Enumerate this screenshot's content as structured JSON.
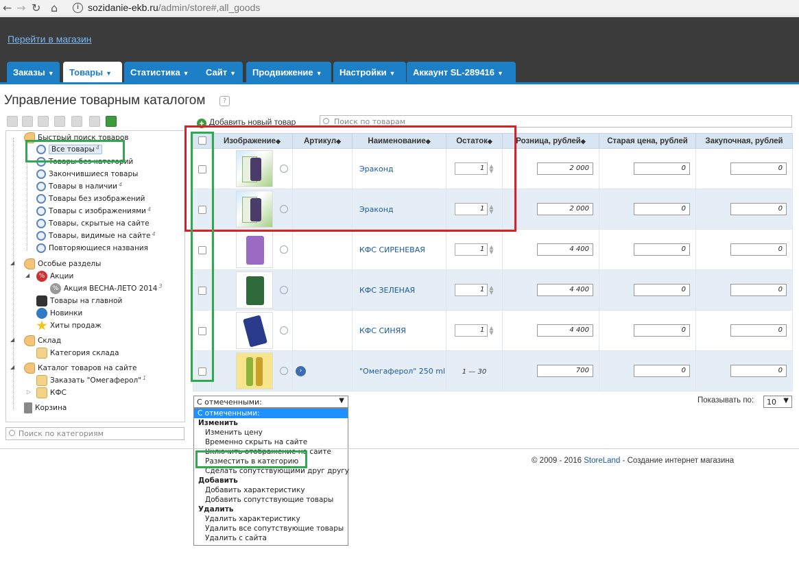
{
  "browser": {
    "url_domain": "sozidanie-ekb.ru",
    "url_path": "/admin/store#,all_goods"
  },
  "header": {
    "shop_link": "Перейти в магазин",
    "tabs": [
      {
        "label": "Заказы"
      },
      {
        "label": "Товары"
      },
      {
        "label": "Статистика"
      },
      {
        "label": "Сайт"
      },
      {
        "label": "Продвижение"
      },
      {
        "label": "Настройки"
      },
      {
        "label": "Аккаунт SL-289416"
      }
    ]
  },
  "page": {
    "title": "Управление товарным каталогом",
    "help": "?"
  },
  "tree": {
    "quick_search": "Быстрый поиск товаров",
    "quick_items": [
      {
        "label": "Все товары",
        "count": "4"
      },
      {
        "label": "Товары без категорий",
        "count": ""
      },
      {
        "label": "Закончившиеся товары",
        "count": ""
      },
      {
        "label": "Товары в наличии",
        "count": "4"
      },
      {
        "label": "Товары без изображений",
        "count": ""
      },
      {
        "label": "Товары с изображениями",
        "count": "4"
      },
      {
        "label": "Товары, скрытые на сайте",
        "count": ""
      },
      {
        "label": "Товары, видимые на сайте",
        "count": "4"
      },
      {
        "label": "Повторяющиеся названия",
        "count": ""
      }
    ],
    "special": "Особые разделы",
    "promos": "Акции",
    "promo_item": "Акция ВЕСНА-ЛЕТО 2014",
    "promo_item_count": "3",
    "on_main": "Товары на главной",
    "news": "Новинки",
    "hits": "Хиты продаж",
    "warehouse": "Склад",
    "warehouse_cat": "Категория склада",
    "catalog": "Каталог товаров на сайте",
    "cat_order": "Заказать \"Омегаферол\"",
    "cat_order_count": "1",
    "cat_kfs": "КФС",
    "trash": "Корзина",
    "search_placeholder": "Поиск по категориям"
  },
  "toolbar": {
    "add_product": "Добавить новый товар",
    "search_placeholder": "Поиск по товарам"
  },
  "table": {
    "headers": {
      "image": "Изображение",
      "sku": "Артикул",
      "name": "Наименование",
      "stock": "Остаток",
      "retail": "Розница, рублей",
      "old_price": "Старая цена, рублей",
      "purchase": "Закупочная, рублей"
    },
    "rows": [
      {
        "name": "Эраконд",
        "stock": "1",
        "retail": "2 000",
        "old": "0",
        "purchase": "0"
      },
      {
        "name": "Эраконд",
        "stock": "1",
        "retail": "2 000",
        "old": "0",
        "purchase": "0"
      },
      {
        "name": "КФС СИРЕНЕВАЯ",
        "stock": "1",
        "retail": "4 400",
        "old": "0",
        "purchase": "0"
      },
      {
        "name": "КФС ЗЕЛЕНАЯ",
        "stock": "1",
        "retail": "4 400",
        "old": "0",
        "purchase": "0"
      },
      {
        "name": "КФС СИНЯЯ",
        "stock": "1",
        "retail": "4 400",
        "old": "0",
        "purchase": "0"
      },
      {
        "name": "\"Омегаферол\" 250 ml",
        "stock_range": "1 — 30",
        "retail": "700",
        "old": "0",
        "purchase": "0"
      }
    ]
  },
  "bulk": {
    "select_value": "С отмеченными:",
    "options": [
      {
        "label": "С отмеченными:",
        "kind": "selected"
      },
      {
        "label": "Изменить",
        "kind": "group"
      },
      {
        "label": "Изменить цену",
        "kind": "opt"
      },
      {
        "label": "Временно скрыть на сайте",
        "kind": "opt"
      },
      {
        "label": "Включить отображение на сайте",
        "kind": "opt"
      },
      {
        "label": "Разместить в категорию",
        "kind": "opt"
      },
      {
        "label": "Сделать сопутствующими друг другу",
        "kind": "opt"
      },
      {
        "label": "Добавить",
        "kind": "group"
      },
      {
        "label": "Добавить характеристику",
        "kind": "opt"
      },
      {
        "label": "Добавить сопутствующие товары",
        "kind": "opt"
      },
      {
        "label": "Удалить",
        "kind": "group"
      },
      {
        "label": "Удалить характеристику",
        "kind": "opt"
      },
      {
        "label": "Удалить все сопутствующие товары",
        "kind": "opt"
      },
      {
        "label": "Удалить с сайта",
        "kind": "opt"
      }
    ]
  },
  "pagination": {
    "per_page_label": "Показывать по:",
    "per_page_value": "10"
  },
  "footer": {
    "copyright_prefix": "© 2009 - 2016",
    "brand": "StoreLand",
    "suffix": "- Создание интернет магазина"
  },
  "colors": {
    "accent": "#1d7fc6",
    "highlight_red": "#d8202a",
    "highlight_green": "#2fa84f"
  }
}
